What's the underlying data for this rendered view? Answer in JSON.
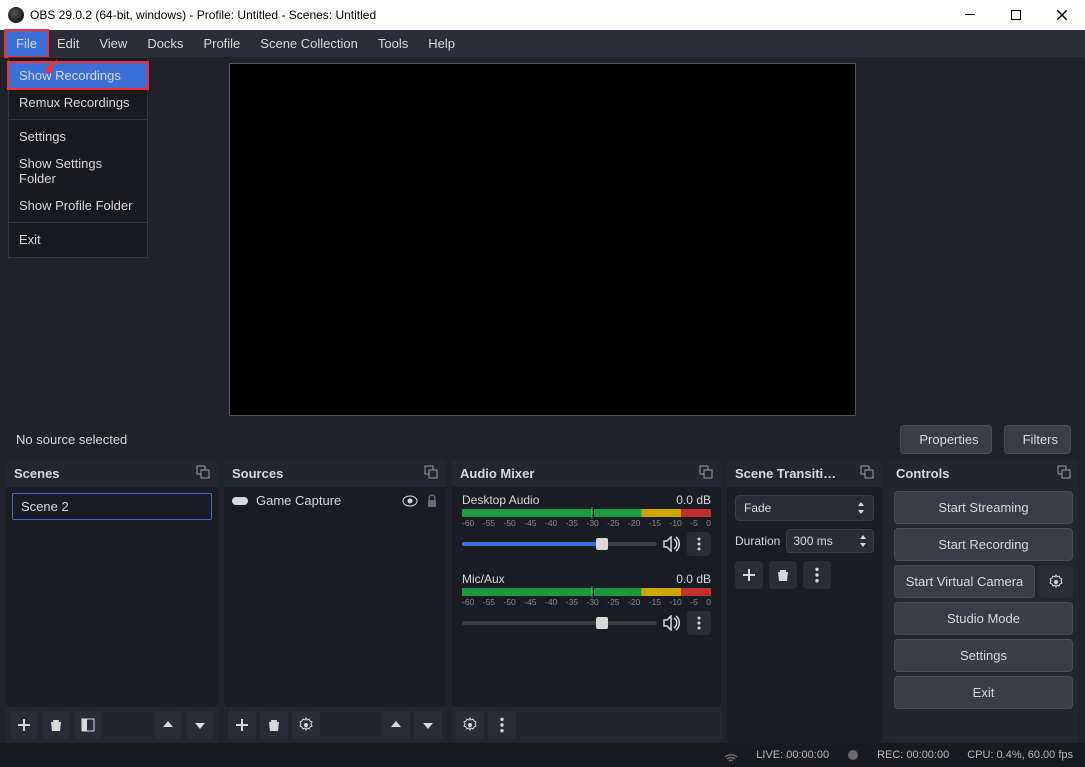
{
  "titlebar": {
    "title": "OBS 29.0.2 (64-bit, windows) - Profile: Untitled - Scenes: Untitled"
  },
  "menubar": [
    "File",
    "Edit",
    "View",
    "Docks",
    "Profile",
    "Scene Collection",
    "Tools",
    "Help"
  ],
  "file_menu": [
    "Show Recordings",
    "Remux Recordings",
    "Settings",
    "Show Settings Folder",
    "Show Profile Folder",
    "Exit"
  ],
  "source_toolbar": {
    "no_source": "No source selected",
    "properties": "Properties",
    "filters": "Filters"
  },
  "panels": {
    "scenes": "Scenes",
    "sources": "Sources",
    "audio": "Audio Mixer",
    "trans": "Scene Transiti…",
    "controls": "Controls"
  },
  "scenes": [
    "Scene 2"
  ],
  "sources": [
    {
      "name": "Game Capture"
    }
  ],
  "audio": {
    "scale": [
      "-60",
      "-55",
      "-50",
      "-45",
      "-40",
      "-35",
      "-30",
      "-25",
      "-20",
      "-15",
      "-10",
      "-5",
      "0"
    ],
    "channels": [
      {
        "name": "Desktop Audio",
        "db": "0.0 dB",
        "fill": 72
      },
      {
        "name": "Mic/Aux",
        "db": "0.0 dB",
        "fill": 72
      }
    ]
  },
  "trans": {
    "type": "Fade",
    "dur_label": "Duration",
    "dur_value": "300 ms"
  },
  "controls": [
    "Start Streaming",
    "Start Recording",
    "Start Virtual Camera",
    "Studio Mode",
    "Settings",
    "Exit"
  ],
  "statusbar": {
    "live": "LIVE: 00:00:00",
    "rec": "REC: 00:00:00",
    "cpu": "CPU: 0.4%, 60.00 fps"
  }
}
